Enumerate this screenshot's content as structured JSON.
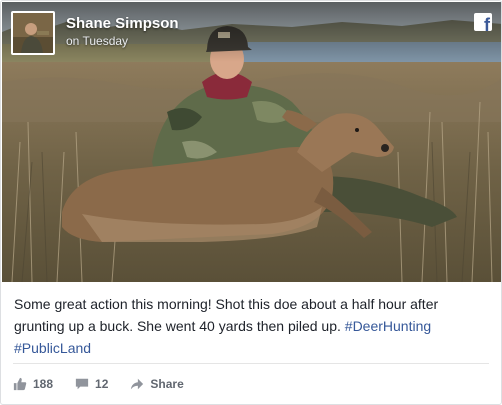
{
  "header": {
    "author": "Shane Simpson",
    "timestamp": "on Tuesday",
    "platform_icon": "facebook-f-icon"
  },
  "post": {
    "text_main": "Some great action this morning! Shot this doe about a half hour after grunting up a buck. She went 40 yards then piled up. ",
    "hashtags": [
      "#DeerHunting",
      "#PublicLand"
    ]
  },
  "actions": {
    "likes": "188",
    "comments": "12",
    "share_label": "Share"
  },
  "colors": {
    "link": "#365899",
    "muted": "#616770",
    "fb_blue": "#3b5998"
  }
}
